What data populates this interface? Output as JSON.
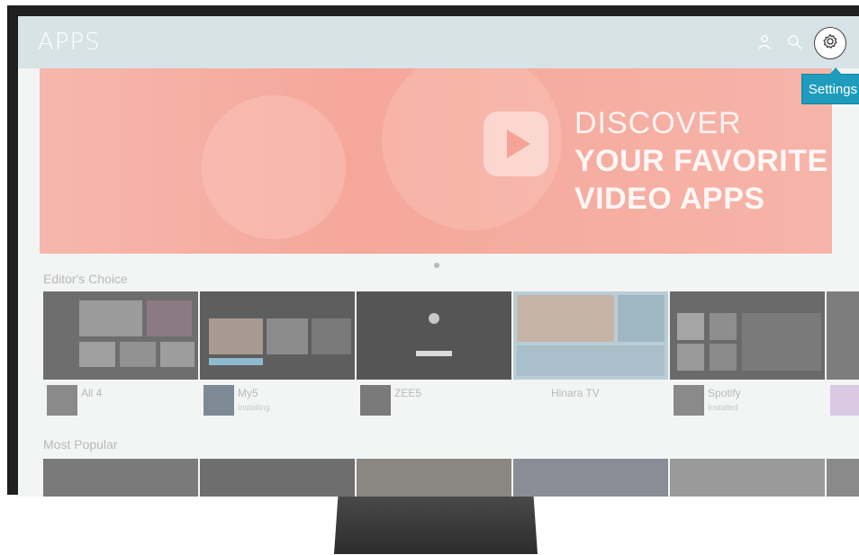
{
  "header": {
    "title": "APPS",
    "icons": [
      "person-icon",
      "search-icon",
      "gear-icon"
    ]
  },
  "tooltip": {
    "label": "Settings"
  },
  "banner": {
    "line1": "DISCOVER",
    "line2": "YOUR FAVORITE",
    "line3": "VIDEO APPS"
  },
  "sections": {
    "editors_choice": "Editor's Choice",
    "most_popular": "Most Popular"
  },
  "apps": [
    {
      "name": "All 4",
      "status": ""
    },
    {
      "name": "My5",
      "status": "Installing"
    },
    {
      "name": "ZEE5",
      "status": ""
    },
    {
      "name": "Hinara TV",
      "status": ""
    },
    {
      "name": "Spotify",
      "status": "Installed"
    },
    {
      "name": "",
      "status": ""
    }
  ],
  "colors": {
    "tooltip": "#1e9bbd",
    "banner": "#f5a79a",
    "header": "#d7e3e6"
  }
}
